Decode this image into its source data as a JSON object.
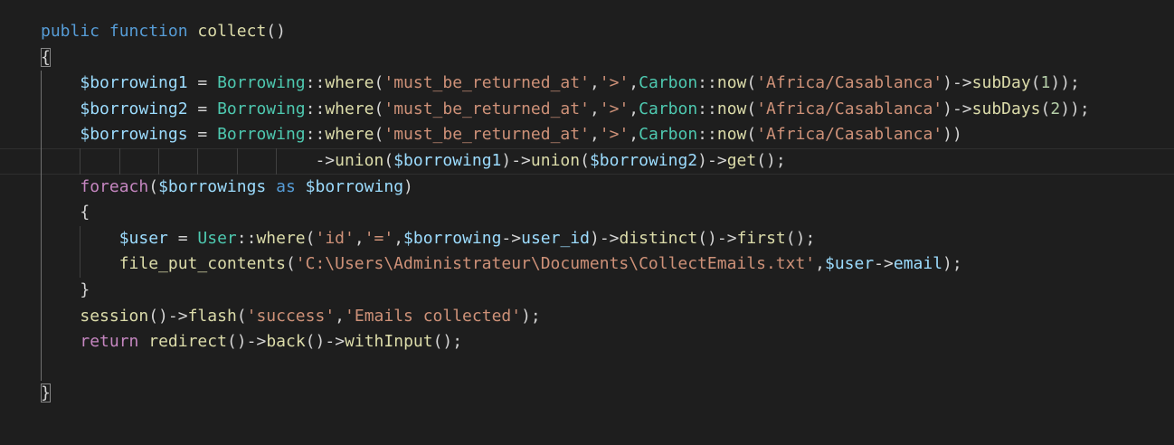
{
  "editor": {
    "language": "php",
    "theme": "dark",
    "background": "#1e1e1e",
    "indent_guides": true,
    "current_line": 6,
    "bracket_match_lines": [
      2,
      15
    ],
    "colors": {
      "keyword": "#569cd6",
      "control": "#c586c0",
      "function": "#dcdcaa",
      "variable": "#9cdcfe",
      "class": "#4ec9b0",
      "string": "#ce9178",
      "number": "#b5cea8",
      "punctuation": "#d4d4d4"
    }
  },
  "lines": [
    {
      "n": 1,
      "tokens": [
        [
          "kw",
          "public"
        ],
        [
          "punc",
          " "
        ],
        [
          "kw",
          "function"
        ],
        [
          "punc",
          " "
        ],
        [
          "fn",
          "collect"
        ],
        [
          "punc",
          "()"
        ]
      ]
    },
    {
      "n": 2,
      "tokens": [
        [
          "br",
          "{"
        ]
      ]
    },
    {
      "n": 3,
      "tokens": [
        [
          "punc",
          "    "
        ],
        [
          "var",
          "$borrowing1"
        ],
        [
          "op",
          " = "
        ],
        [
          "cls",
          "Borrowing"
        ],
        [
          "op",
          "::"
        ],
        [
          "fn",
          "where"
        ],
        [
          "punc",
          "("
        ],
        [
          "str",
          "'must_be_returned_at'"
        ],
        [
          "punc",
          ","
        ],
        [
          "str",
          "'>'"
        ],
        [
          "punc",
          ","
        ],
        [
          "cls",
          "Carbon"
        ],
        [
          "op",
          "::"
        ],
        [
          "fn",
          "now"
        ],
        [
          "punc",
          "("
        ],
        [
          "str",
          "'Africa/Casablanca'"
        ],
        [
          "punc",
          ")"
        ],
        [
          "op",
          "->"
        ],
        [
          "fn",
          "subDay"
        ],
        [
          "punc",
          "("
        ],
        [
          "num",
          "1"
        ],
        [
          "punc",
          "));"
        ]
      ]
    },
    {
      "n": 4,
      "tokens": [
        [
          "punc",
          "    "
        ],
        [
          "var",
          "$borrowing2"
        ],
        [
          "op",
          " = "
        ],
        [
          "cls",
          "Borrowing"
        ],
        [
          "op",
          "::"
        ],
        [
          "fn",
          "where"
        ],
        [
          "punc",
          "("
        ],
        [
          "str",
          "'must_be_returned_at'"
        ],
        [
          "punc",
          ","
        ],
        [
          "str",
          "'>'"
        ],
        [
          "punc",
          ","
        ],
        [
          "cls",
          "Carbon"
        ],
        [
          "op",
          "::"
        ],
        [
          "fn",
          "now"
        ],
        [
          "punc",
          "("
        ],
        [
          "str",
          "'Africa/Casablanca'"
        ],
        [
          "punc",
          ")"
        ],
        [
          "op",
          "->"
        ],
        [
          "fn",
          "subDays"
        ],
        [
          "punc",
          "("
        ],
        [
          "num",
          "2"
        ],
        [
          "punc",
          "));"
        ]
      ]
    },
    {
      "n": 5,
      "tokens": [
        [
          "punc",
          "    "
        ],
        [
          "var",
          "$borrowings"
        ],
        [
          "op",
          " = "
        ],
        [
          "cls",
          "Borrowing"
        ],
        [
          "op",
          "::"
        ],
        [
          "fn",
          "where"
        ],
        [
          "punc",
          "("
        ],
        [
          "str",
          "'must_be_returned_at'"
        ],
        [
          "punc",
          ","
        ],
        [
          "str",
          "'>'"
        ],
        [
          "punc",
          ","
        ],
        [
          "cls",
          "Carbon"
        ],
        [
          "op",
          "::"
        ],
        [
          "fn",
          "now"
        ],
        [
          "punc",
          "("
        ],
        [
          "str",
          "'Africa/Casablanca'"
        ],
        [
          "punc",
          "))"
        ]
      ]
    },
    {
      "n": 6,
      "tokens": [
        [
          "punc",
          "                            "
        ],
        [
          "op",
          "->"
        ],
        [
          "fn",
          "union"
        ],
        [
          "punc",
          "("
        ],
        [
          "var",
          "$borrowing1"
        ],
        [
          "punc",
          ")"
        ],
        [
          "op",
          "->"
        ],
        [
          "fn",
          "union"
        ],
        [
          "punc",
          "("
        ],
        [
          "var",
          "$borrowing2"
        ],
        [
          "punc",
          ")"
        ],
        [
          "op",
          "->"
        ],
        [
          "fn",
          "get"
        ],
        [
          "punc",
          "();"
        ]
      ]
    },
    {
      "n": 7,
      "tokens": [
        [
          "punc",
          "    "
        ],
        [
          "ctl",
          "foreach"
        ],
        [
          "punc",
          "("
        ],
        [
          "var",
          "$borrowings"
        ],
        [
          "punc",
          " "
        ],
        [
          "kw",
          "as"
        ],
        [
          "punc",
          " "
        ],
        [
          "var",
          "$borrowing"
        ],
        [
          "punc",
          ")"
        ]
      ]
    },
    {
      "n": 8,
      "tokens": [
        [
          "punc",
          "    "
        ],
        [
          "br",
          "{"
        ]
      ]
    },
    {
      "n": 9,
      "tokens": [
        [
          "punc",
          "        "
        ],
        [
          "var",
          "$user"
        ],
        [
          "op",
          " = "
        ],
        [
          "cls",
          "User"
        ],
        [
          "op",
          "::"
        ],
        [
          "fn",
          "where"
        ],
        [
          "punc",
          "("
        ],
        [
          "str",
          "'id'"
        ],
        [
          "punc",
          ","
        ],
        [
          "str",
          "'='"
        ],
        [
          "punc",
          ","
        ],
        [
          "var",
          "$borrowing"
        ],
        [
          "op",
          "->"
        ],
        [
          "var",
          "user_id"
        ],
        [
          "punc",
          ")"
        ],
        [
          "op",
          "->"
        ],
        [
          "fn",
          "distinct"
        ],
        [
          "punc",
          "()"
        ],
        [
          "op",
          "->"
        ],
        [
          "fn",
          "first"
        ],
        [
          "punc",
          "();"
        ]
      ]
    },
    {
      "n": 10,
      "tokens": [
        [
          "punc",
          "        "
        ],
        [
          "fn",
          "file_put_contents"
        ],
        [
          "punc",
          "("
        ],
        [
          "str",
          "'C:\\Users\\Administrateur\\Documents\\CollectEmails.txt'"
        ],
        [
          "punc",
          ","
        ],
        [
          "var",
          "$user"
        ],
        [
          "op",
          "->"
        ],
        [
          "var",
          "email"
        ],
        [
          "punc",
          ");"
        ]
      ]
    },
    {
      "n": 11,
      "tokens": [
        [
          "punc",
          "    "
        ],
        [
          "br",
          "}"
        ]
      ]
    },
    {
      "n": 12,
      "tokens": [
        [
          "punc",
          "    "
        ],
        [
          "fn",
          "session"
        ],
        [
          "punc",
          "()"
        ],
        [
          "op",
          "->"
        ],
        [
          "fn",
          "flash"
        ],
        [
          "punc",
          "("
        ],
        [
          "str",
          "'success'"
        ],
        [
          "punc",
          ","
        ],
        [
          "str",
          "'Emails collected'"
        ],
        [
          "punc",
          ");"
        ]
      ]
    },
    {
      "n": 13,
      "tokens": [
        [
          "punc",
          "    "
        ],
        [
          "ctl",
          "return"
        ],
        [
          "punc",
          " "
        ],
        [
          "fn",
          "redirect"
        ],
        [
          "punc",
          "()"
        ],
        [
          "op",
          "->"
        ],
        [
          "fn",
          "back"
        ],
        [
          "punc",
          "()"
        ],
        [
          "op",
          "->"
        ],
        [
          "fn",
          "withInput"
        ],
        [
          "punc",
          "();"
        ]
      ]
    },
    {
      "n": 14,
      "tokens": []
    },
    {
      "n": 15,
      "tokens": [
        [
          "br",
          "}"
        ]
      ]
    }
  ]
}
